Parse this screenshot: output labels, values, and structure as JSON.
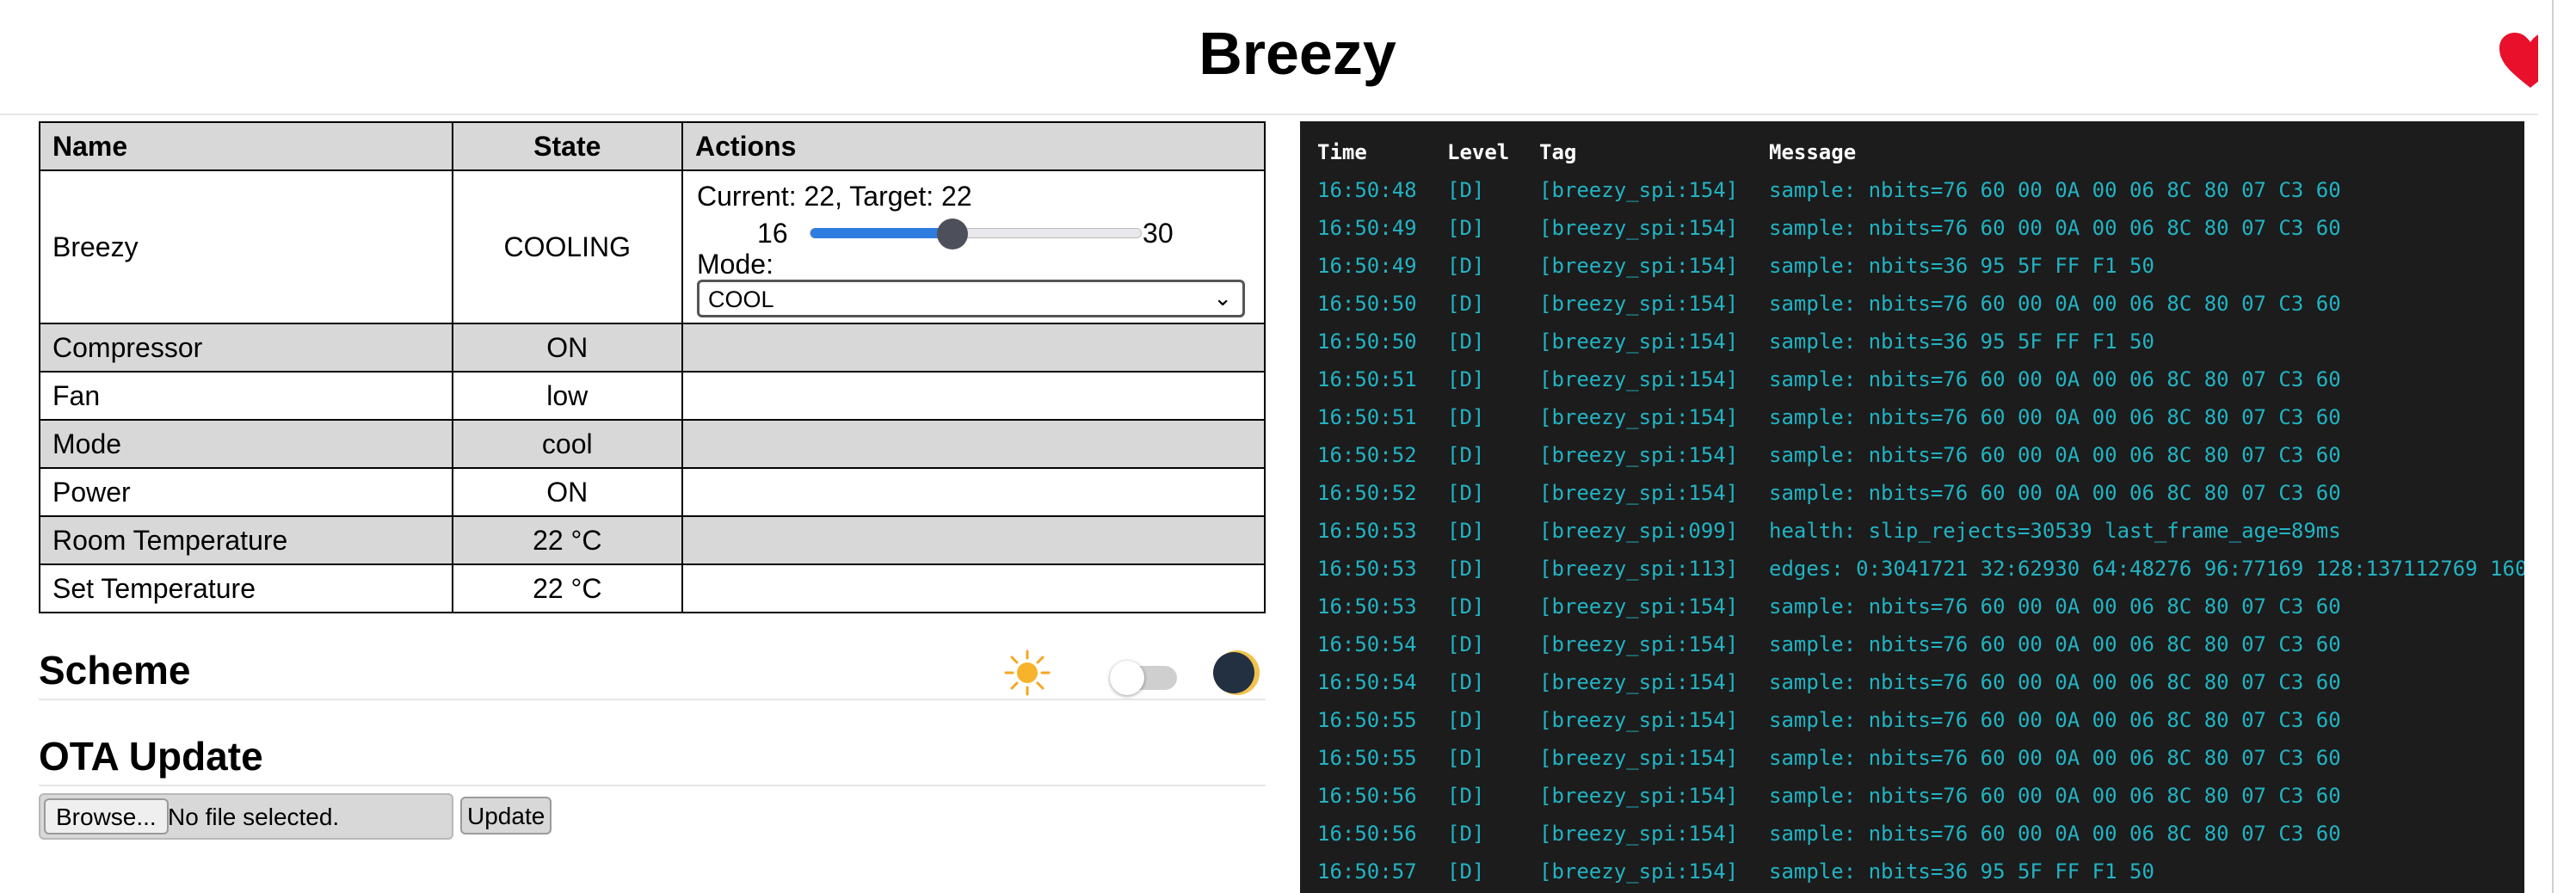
{
  "header": {
    "title": "Breezy",
    "heart_icon": "heart-icon",
    "heart_color": "#e8102a"
  },
  "entities": {
    "columns": [
      "Name",
      "State",
      "Actions"
    ],
    "climate": {
      "name": "Breezy",
      "state": "COOLING",
      "current_target": "Current: 22, Target: 22",
      "slider_min": "16",
      "slider_max": "30",
      "slider_value": 22,
      "slider_min_value": 16,
      "slider_max_value": 30,
      "mode_label": "Mode:",
      "mode_value": "COOL"
    },
    "rows": [
      {
        "name": "Compressor",
        "state": "ON"
      },
      {
        "name": "Fan",
        "state": "low"
      },
      {
        "name": "Mode",
        "state": "cool"
      },
      {
        "name": "Power",
        "state": "ON"
      },
      {
        "name": "Room Temperature",
        "state": "22 °C"
      },
      {
        "name": "Set Temperature",
        "state": "22 °C"
      }
    ]
  },
  "scheme": {
    "title": "Scheme",
    "light_icon": "sun-icon",
    "dark_icon": "moon-icon",
    "dark_enabled": false
  },
  "ota": {
    "title": "OTA Update",
    "browse_label": "Browse...",
    "file_status": "No file selected.",
    "update_label": "Update"
  },
  "log": {
    "columns": [
      "Time",
      "Level",
      "Tag",
      "Message"
    ],
    "text_color": "#22b3c3",
    "background": "#1c1c1c",
    "rows": [
      [
        "16:50:48",
        "[D]",
        "[breezy_spi:154]",
        "sample: nbits=76 60 00 0A 00 06 8C 80 07 C3 60"
      ],
      [
        "16:50:49",
        "[D]",
        "[breezy_spi:154]",
        "sample: nbits=76 60 00 0A 00 06 8C 80 07 C3 60"
      ],
      [
        "16:50:49",
        "[D]",
        "[breezy_spi:154]",
        "sample: nbits=36 95 5F FF F1 50"
      ],
      [
        "16:50:50",
        "[D]",
        "[breezy_spi:154]",
        "sample: nbits=76 60 00 0A 00 06 8C 80 07 C3 60"
      ],
      [
        "16:50:50",
        "[D]",
        "[breezy_spi:154]",
        "sample: nbits=36 95 5F FF F1 50"
      ],
      [
        "16:50:51",
        "[D]",
        "[breezy_spi:154]",
        "sample: nbits=76 60 00 0A 00 06 8C 80 07 C3 60"
      ],
      [
        "16:50:51",
        "[D]",
        "[breezy_spi:154]",
        "sample: nbits=76 60 00 0A 00 06 8C 80 07 C3 60"
      ],
      [
        "16:50:52",
        "[D]",
        "[breezy_spi:154]",
        "sample: nbits=76 60 00 0A 00 06 8C 80 07 C3 60"
      ],
      [
        "16:50:52",
        "[D]",
        "[breezy_spi:154]",
        "sample: nbits=76 60 00 0A 00 06 8C 80 07 C3 60"
      ],
      [
        "16:50:53",
        "[D]",
        "[breezy_spi:099]",
        "health: slip_rejects=30539 last_frame_age=89ms"
      ],
      [
        "16:50:53",
        "[D]",
        "[breezy_spi:113]",
        "edges: 0:3041721 32:62930 64:48276 96:77169 128:137112769 160"
      ],
      [
        "16:50:53",
        "[D]",
        "[breezy_spi:154]",
        "sample: nbits=76 60 00 0A 00 06 8C 80 07 C3 60"
      ],
      [
        "16:50:54",
        "[D]",
        "[breezy_spi:154]",
        "sample: nbits=76 60 00 0A 00 06 8C 80 07 C3 60"
      ],
      [
        "16:50:54",
        "[D]",
        "[breezy_spi:154]",
        "sample: nbits=76 60 00 0A 00 06 8C 80 07 C3 60"
      ],
      [
        "16:50:55",
        "[D]",
        "[breezy_spi:154]",
        "sample: nbits=76 60 00 0A 00 06 8C 80 07 C3 60"
      ],
      [
        "16:50:55",
        "[D]",
        "[breezy_spi:154]",
        "sample: nbits=76 60 00 0A 00 06 8C 80 07 C3 60"
      ],
      [
        "16:50:56",
        "[D]",
        "[breezy_spi:154]",
        "sample: nbits=76 60 00 0A 00 06 8C 80 07 C3 60"
      ],
      [
        "16:50:56",
        "[D]",
        "[breezy_spi:154]",
        "sample: nbits=76 60 00 0A 00 06 8C 80 07 C3 60"
      ],
      [
        "16:50:57",
        "[D]",
        "[breezy_spi:154]",
        "sample: nbits=36 95 5F FF F1 50"
      ]
    ]
  }
}
